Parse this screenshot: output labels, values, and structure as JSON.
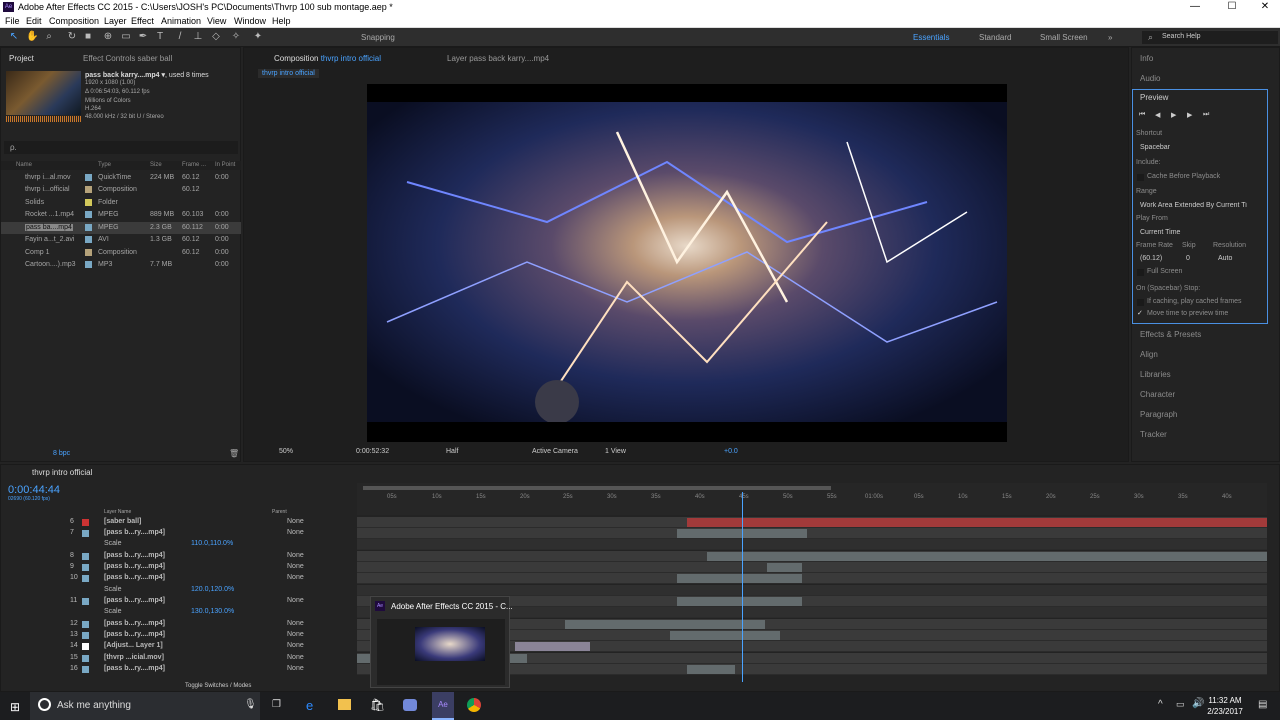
{
  "window": {
    "title": "Adobe After Effects CC 2015 - C:\\Users\\JOSH's PC\\Documents\\Thvrp 100 sub montage.aep *",
    "minimize": "—",
    "maximize": "☐",
    "close": "✕"
  },
  "menu": [
    "File",
    "Edit",
    "Composition",
    "Layer",
    "Effect",
    "Animation",
    "View",
    "Window",
    "Help"
  ],
  "toolbar": {
    "snapping": "Snapping",
    "workspaces": [
      "Essentials",
      "Standard",
      "Small Screen"
    ],
    "search_placeholder": "Search Help"
  },
  "project": {
    "tab": "Project",
    "effect_tab": "Effect Controls saber ball",
    "selected": {
      "name": "pass back karry....mp4 ▾",
      "used": ", used 8 times",
      "dims": "1920 x 1080 (1.00)",
      "duration": "Δ 0:06:54:03, 60.112 fps",
      "colors": "Millions of Colors",
      "codec": "H.264",
      "audio": "48.000 kHz / 32 bit U / Stereo"
    },
    "search_placeholder": "ρ.",
    "columns": [
      "Name",
      "Type",
      "Size",
      "Frame ...",
      "In Point"
    ],
    "items": [
      {
        "name": "thvrp i...al.mov",
        "type": "QuickTime",
        "size": "224 MB",
        "fps": "60.12",
        "in": "0:00",
        "color": "#79a8c4"
      },
      {
        "name": "thvrp i...official",
        "type": "Composition",
        "size": "",
        "fps": "60.12",
        "in": "",
        "color": "#b5a27a"
      },
      {
        "name": "Solids",
        "type": "Folder",
        "size": "",
        "fps": "",
        "in": "",
        "color": "#d2c85b"
      },
      {
        "name": "Rocket ...1.mp4",
        "type": "MPEG",
        "size": "889 MB",
        "fps": "60.103",
        "in": "0:00",
        "color": "#79a8c4"
      },
      {
        "name": "pass ba....mp4",
        "type": "MPEG",
        "size": "2.3 GB",
        "fps": "60.112",
        "in": "0:00",
        "color": "#79a8c4"
      },
      {
        "name": "Fayin a...t_2.avi",
        "type": "AVI",
        "size": "1.3 GB",
        "fps": "60.12",
        "in": "0:00",
        "color": "#79a8c4"
      },
      {
        "name": "Comp 1",
        "type": "Composition",
        "size": "",
        "fps": "60.12",
        "in": "0:00",
        "color": "#b5a27a"
      },
      {
        "name": "Cartoon....).mp3",
        "type": "MP3",
        "size": "7.7 MB",
        "fps": "",
        "in": "0:00",
        "color": "#79a8c4"
      }
    ],
    "bpc": "8 bpc"
  },
  "composition": {
    "tab": "Composition",
    "tab_name": "thvrp intro official",
    "layer_tab": "Layer pass back karry....mp4",
    "breadcrumb": "thvrp intro official",
    "footer": {
      "zoom": "50%",
      "time": "0:00:52:32",
      "res": "Half",
      "camera": "Active Camera",
      "view": "1 View",
      "exposure": "+0.0"
    }
  },
  "right_panel": {
    "info": "Info",
    "audio": "Audio",
    "preview": "Preview",
    "shortcut_label": "Shortcut",
    "shortcut": "Spacebar",
    "include": "Include:",
    "cache": "Cache Before Playback",
    "range_label": "Range",
    "range": "Work Area Extended By Current Ti",
    "play_from_label": "Play From",
    "play_from": "Current Time",
    "fr_label": "Frame Rate",
    "skip_label": "Skip",
    "res_label": "Resolution",
    "fr": "(60.12)",
    "skip": "0",
    "res": "Auto",
    "full_screen": "Full Screen",
    "stop_label": "On (Spacebar) Stop:",
    "if_caching": "If caching, play cached frames",
    "move_time": "Move time to preview time",
    "panels": [
      "Effects & Presets",
      "Align",
      "Libraries",
      "Character",
      "Paragraph",
      "Tracker"
    ]
  },
  "timeline": {
    "tab": "thvrp intro official",
    "timecode": "0:00:44:44",
    "frame": "02690 (60.120 fps)",
    "col_layer": "Layer Name",
    "col_parent": "Parent",
    "toggle": "Toggle Switches / Modes",
    "ruler_left": [
      "05s",
      "10s",
      "15s",
      "20s",
      "25s",
      "30s",
      "35s",
      "40s",
      "45s",
      "50s",
      "55s"
    ],
    "ruler_right": [
      "01:00s",
      "05s",
      "10s",
      "15s",
      "20s",
      "25s",
      "30s",
      "35s",
      "40s"
    ],
    "layers": [
      {
        "num": "6",
        "name": "[saber ball]",
        "parent": "None",
        "label": "#c33"
      },
      {
        "num": "7",
        "name": "[pass b...ry....mp4]",
        "parent": "None",
        "label": "#79a8c4"
      },
      {
        "num": "",
        "name": "Scale",
        "value": "110.0,110.0%",
        "parent": "",
        "label": ""
      },
      {
        "num": "8",
        "name": "[pass b...ry....mp4]",
        "parent": "None",
        "label": "#79a8c4"
      },
      {
        "num": "9",
        "name": "[pass b...ry....mp4]",
        "parent": "None",
        "label": "#79a8c4"
      },
      {
        "num": "10",
        "name": "[pass b...ry....mp4]",
        "parent": "None",
        "label": "#79a8c4"
      },
      {
        "num": "",
        "name": "Scale",
        "value": "120.0,120.0%",
        "parent": "",
        "label": ""
      },
      {
        "num": "11",
        "name": "[pass b...ry....mp4]",
        "parent": "None",
        "label": "#79a8c4"
      },
      {
        "num": "",
        "name": "Scale",
        "value": "130.0,130.0%",
        "parent": "",
        "label": ""
      },
      {
        "num": "12",
        "name": "[pass b...ry....mp4]",
        "parent": "None",
        "label": "#79a8c4"
      },
      {
        "num": "13",
        "name": "[pass b...ry....mp4]",
        "parent": "None",
        "label": "#79a8c4"
      },
      {
        "num": "14",
        "name": "[Adjust... Layer 1]",
        "parent": "None",
        "label": "#fff"
      },
      {
        "num": "15",
        "name": "[thvrp ...icial.mov]",
        "parent": "None",
        "label": "#79a8c4"
      },
      {
        "num": "16",
        "name": "[pass b...ry....mp4]",
        "parent": "None",
        "label": "#79a8c4"
      }
    ]
  },
  "popup": {
    "title": "Adobe After Effects CC 2015 - C..."
  },
  "taskbar": {
    "search": "Ask me anything",
    "time": "11:32 AM",
    "date": "2/23/2017"
  }
}
